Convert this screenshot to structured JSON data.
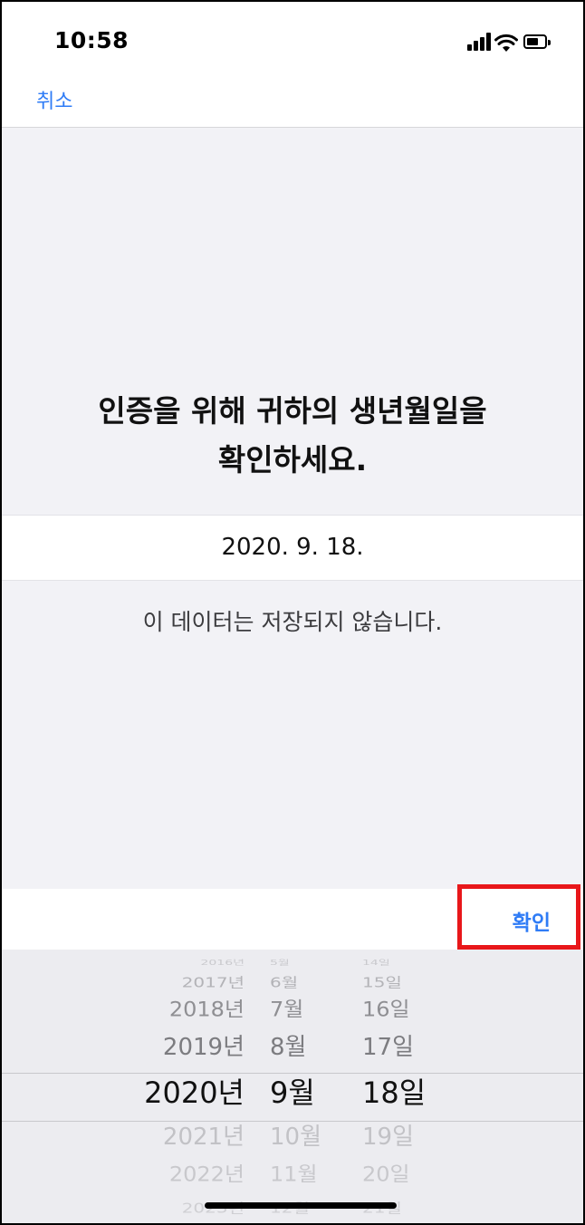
{
  "status_bar": {
    "time": "10:58",
    "signal_icon": "signal-bars-icon",
    "wifi_icon": "wifi-icon",
    "battery_icon": "battery-icon"
  },
  "nav": {
    "cancel_label": "취소"
  },
  "prompt": {
    "line1": "인증을 위해 귀하의 생년월일을",
    "line2": "확인하세요."
  },
  "date_field": {
    "value": "2020. 9. 18."
  },
  "notice": "이 데이터는 저장되지 않습니다.",
  "toolbar": {
    "confirm_label": "확인"
  },
  "picker": {
    "years": [
      "2016년",
      "2017년",
      "2018년",
      "2019년",
      "2020년",
      "2021년",
      "2022년",
      "2023년"
    ],
    "months": [
      "5월",
      "6월",
      "7월",
      "8월",
      "9월",
      "10월",
      "11월",
      "12월"
    ],
    "days": [
      "14일",
      "15일",
      "16일",
      "17일",
      "18일",
      "19일",
      "20일",
      "21일"
    ],
    "selected_index": 4
  },
  "colors": {
    "accent": "#2f7cf6",
    "highlight_box": "#e8171a",
    "background_grey": "#f2f2f6"
  }
}
